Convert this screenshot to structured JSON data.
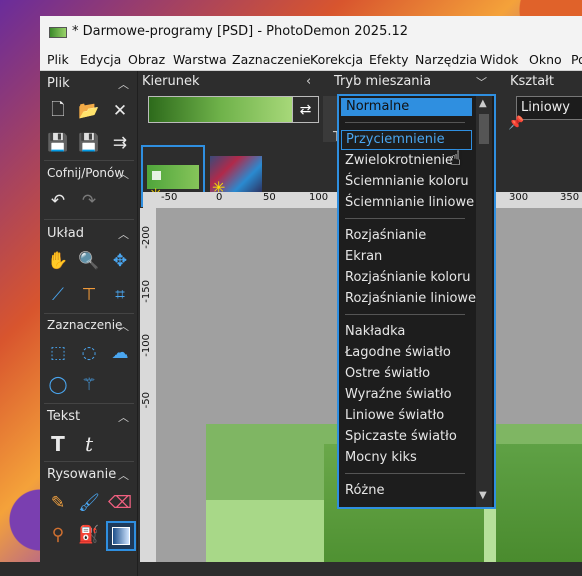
{
  "window": {
    "title": "* Darmowe-programy [PSD]  -  PhotoDemon 2025.12"
  },
  "menu": [
    "Plik",
    "Edycja",
    "Obraz",
    "Warstwa",
    "Zaznaczenie",
    "Korekcja",
    "Efekty",
    "Narzędzia",
    "Widok",
    "Okno",
    "Pomo"
  ],
  "left_panel": {
    "sections": {
      "file": "Plik",
      "undo": "Cofnij/Ponów",
      "layout": "Układ",
      "selection": "Zaznaczenie",
      "text": "Tekst",
      "draw": "Rysowanie"
    }
  },
  "toolbar": {
    "direction_label": "Kierunek",
    "blend_label": "Tryb mieszania",
    "shape_label": "Kształt",
    "shape_value": "Liniowy",
    "partial_label": "T"
  },
  "rulers": {
    "h_ticks": [
      "-50",
      "0",
      "50",
      "100",
      "300",
      "350"
    ],
    "v_ticks": [
      "-200",
      "-150",
      "-100",
      "-50"
    ]
  },
  "blend_dropdown": {
    "selected": "Normalne",
    "highlighted": "Przyciemnienie",
    "groups": [
      [
        "Przyciemnienie",
        "Zwielokrotnienie",
        "Ściemnianie koloru",
        "Ściemnianie liniowe"
      ],
      [
        "Rozjaśnianie",
        "Ekran",
        "Rozjaśnianie koloru",
        "Rozjaśnianie liniowe"
      ],
      [
        "Nakładka",
        "Łagodne światło",
        "Ostre światło",
        "Wyraźne światło",
        "Liniowe światło",
        "Spiczaste światło",
        "Mocny kiks"
      ],
      [
        "Różne"
      ]
    ]
  }
}
